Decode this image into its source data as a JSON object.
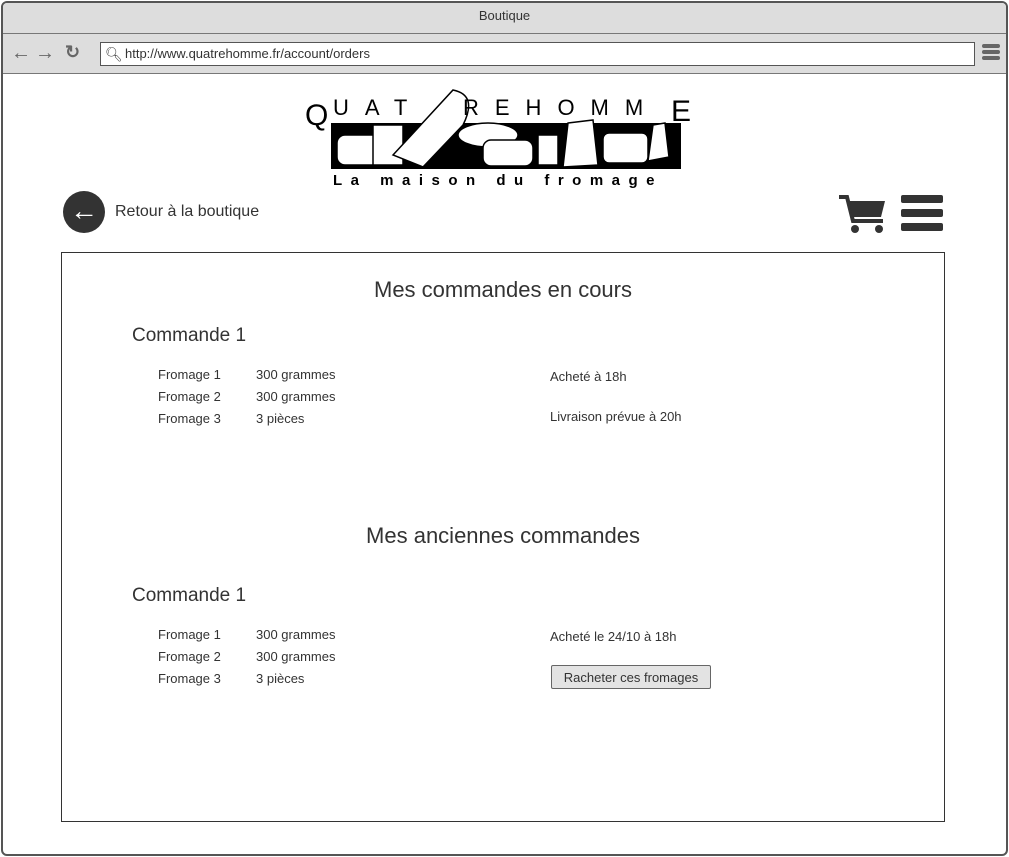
{
  "window": {
    "title": "Boutique",
    "url": "http://www.quatrehomme.fr/account/orders"
  },
  "logo": {
    "name": "QUATREHOMME",
    "tagline": "La maison du fromage"
  },
  "header": {
    "back_label": "Retour à la boutique",
    "icons": [
      "arrow-left-circle-icon",
      "cart-icon",
      "menu-icon"
    ]
  },
  "current": {
    "title": "Mes commandes en cours",
    "order": {
      "title": "Commande 1",
      "items": [
        {
          "name": "Fromage 1",
          "qty": "300 grammes"
        },
        {
          "name": "Fromage 2",
          "qty": "300 grammes"
        },
        {
          "name": "Fromage 3",
          "qty": "3 pièces"
        }
      ],
      "bought": "Acheté à 18h",
      "delivery": "Livraison prévue à 20h"
    }
  },
  "past": {
    "title": "Mes anciennes commandes",
    "order": {
      "title": "Commande 1",
      "items": [
        {
          "name": "Fromage 1",
          "qty": "300 grammes"
        },
        {
          "name": "Fromage 2",
          "qty": "300 grammes"
        },
        {
          "name": "Fromage 3",
          "qty": "3 pièces"
        }
      ],
      "bought": "Acheté le 24/10 à 18h",
      "rebuy_label": "Racheter ces fromages"
    }
  }
}
